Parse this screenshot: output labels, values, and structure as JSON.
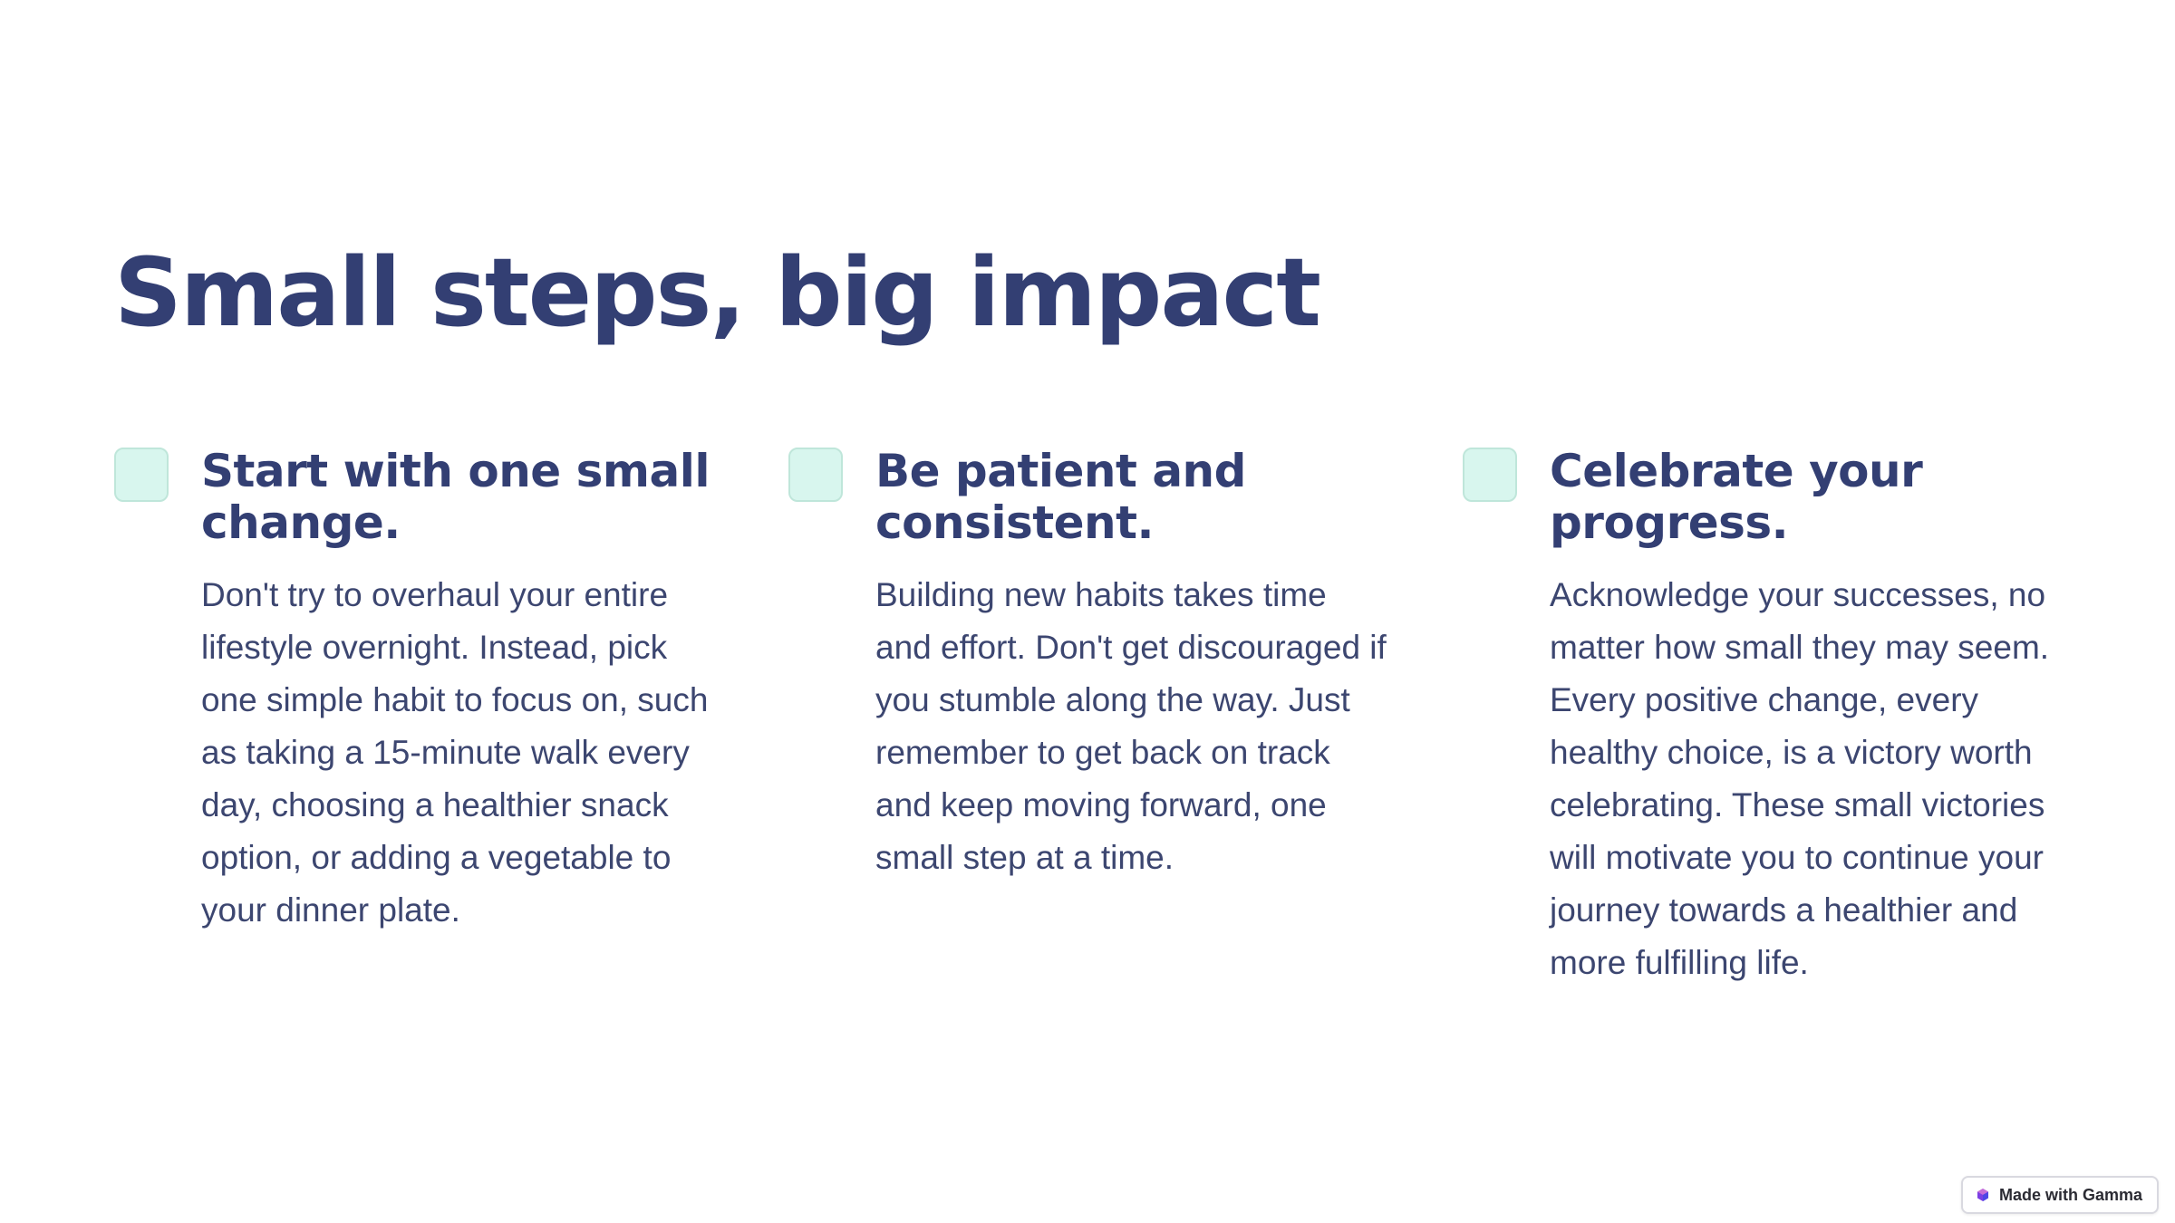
{
  "slide": {
    "title": "Small steps, big impact",
    "columns": [
      {
        "heading": "Start with one small change.",
        "body": "Don't try to overhaul your entire lifestyle overnight. Instead, pick one simple habit to focus on, such as taking a 15-minute walk every day, choosing a healthier snack option, or adding a vegetable to your dinner plate."
      },
      {
        "heading": "Be patient and consistent.",
        "body": "Building new habits takes time and effort. Don't get discouraged if you stumble along the way. Just remember to get back on track and keep moving forward, one small step at a time."
      },
      {
        "heading": "Celebrate your progress.",
        "body": "Acknowledge your successes, no matter how small they may seem. Every positive change, every healthy choice, is a victory worth celebrating. These small victories will motivate you to continue your journey towards a healthier and more fulfilling life."
      }
    ]
  },
  "badge": {
    "label": "Made with Gamma",
    "icon": "gamma-logo-icon"
  },
  "colors": {
    "heading": "#333f73",
    "body_text": "#3c4670",
    "checkbox_fill": "#d8f6ee",
    "checkbox_border": "#bfe6da",
    "background": "#ffffff"
  }
}
